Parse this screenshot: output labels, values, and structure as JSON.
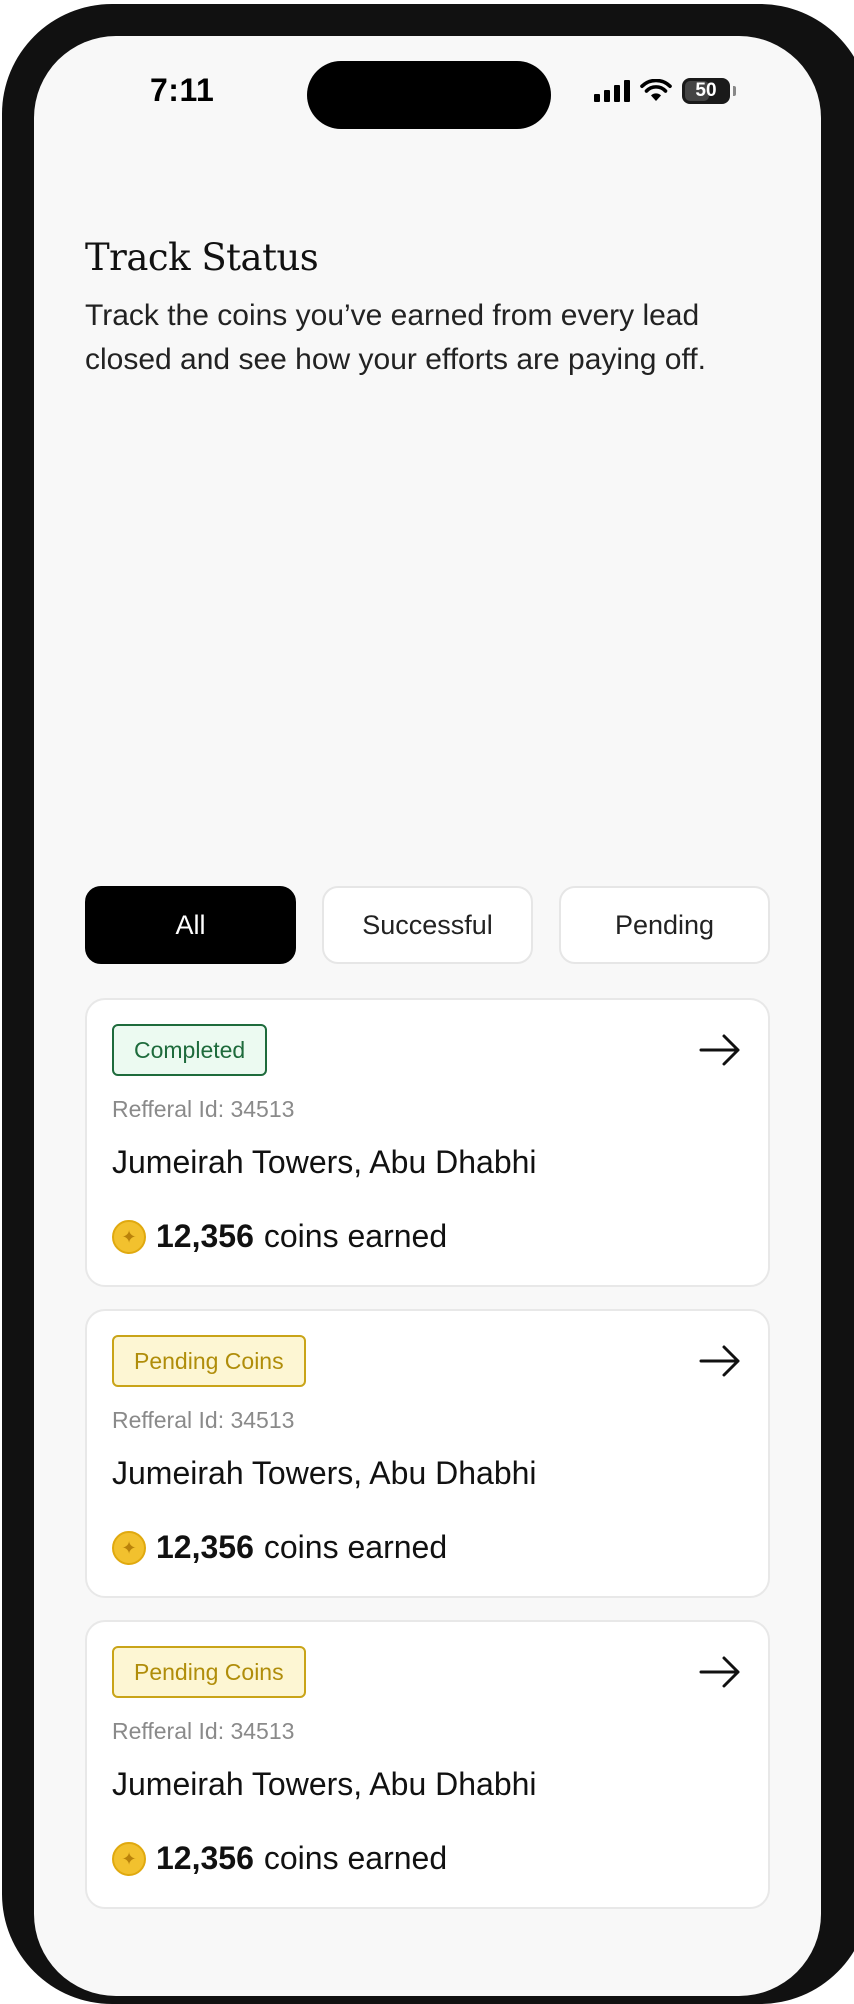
{
  "status_bar": {
    "time": "7:11",
    "battery": "50"
  },
  "header": {
    "title": "Track Status",
    "subtitle": "Track the coins you’ve earned from every lead closed and see how your efforts are paying off."
  },
  "filters": {
    "tabs": [
      {
        "label": "All",
        "active": true
      },
      {
        "label": "Successful",
        "active": false
      },
      {
        "label": "Pending",
        "active": false
      }
    ]
  },
  "referrals": [
    {
      "status": "Completed",
      "status_type": "completed",
      "referral_id": "Refferal Id: 34513",
      "location": "Jumeirah Towers, Abu Dhabhi",
      "coins": "12,356",
      "coins_suffix": "coins earned"
    },
    {
      "status": "Pending Coins",
      "status_type": "pending",
      "referral_id": "Refferal Id: 34513",
      "location": "Jumeirah Towers, Abu Dhabhi",
      "coins": "12,356",
      "coins_suffix": "coins earned"
    },
    {
      "status": "Pending Coins",
      "status_type": "pending",
      "referral_id": "Refferal Id: 34513",
      "location": "Jumeirah Towers, Abu Dhabhi",
      "coins": "12,356",
      "coins_suffix": "coins earned"
    }
  ],
  "colors": {
    "completed": "#1e6b3c",
    "pending": "#c9a418",
    "coin": "#f2c12e"
  },
  "icons": {
    "arrow": "arrow-right-icon",
    "coin": "coin-icon"
  }
}
